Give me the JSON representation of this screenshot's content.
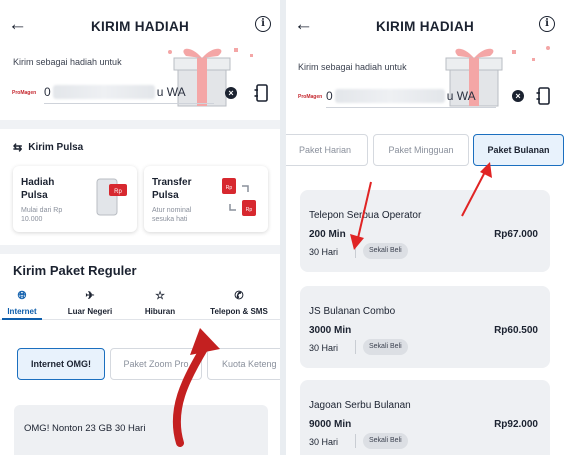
{
  "left": {
    "header": {
      "title": "KIRIM HADIAH",
      "back_icon": "arrow-left-icon",
      "info_icon": "info-icon"
    },
    "gift_label": "Kirim sebagai hadiah untuk",
    "provider_logo": "ProMagen",
    "phone": {
      "prefix": "0",
      "suffix": "u WA"
    },
    "pulsa": {
      "section_title": "Kirim Pulsa",
      "cards": [
        {
          "title": "Hadiah Pulsa",
          "subtitle": "Mulai dari Rp 10.000",
          "icon_text": "Rp"
        },
        {
          "title": "Transfer Pulsa",
          "subtitle": "Atur nominal sesuka hati",
          "icon_text": "Rp"
        }
      ]
    },
    "reguler": {
      "title": "Kirim Paket Reguler",
      "tabs": [
        {
          "label": "Internet",
          "icon": "globe-icon"
        },
        {
          "label": "Luar Negeri",
          "icon": "airplane-icon"
        },
        {
          "label": "Hiburan",
          "icon": "star-icon"
        },
        {
          "label": "Telepon & SMS",
          "icon": "phone-sms-icon"
        }
      ],
      "chips": [
        "Internet OMG!",
        "Paket Zoom Pro",
        "Kuota Keteng"
      ],
      "card_title": "OMG! Nonton 23 GB 30 Hari"
    }
  },
  "right": {
    "header": {
      "title": "KIRIM HADIAH",
      "back_icon": "arrow-left-icon",
      "info_icon": "info-icon"
    },
    "gift_label": "Kirim sebagai hadiah untuk",
    "provider_logo": "ProMagen",
    "phone": {
      "prefix": "0",
      "suffix": "u WA"
    },
    "period_tabs": [
      "Paket Harian",
      "Paket Mingguan",
      "Paket Bulanan"
    ],
    "packages": [
      {
        "name": "Telepon Serbua Operator",
        "quota": "200 Min",
        "price": "Rp67.000",
        "duration": "30 Hari",
        "badge": "Sekali Beli"
      },
      {
        "name": "JS Bulanan Combo",
        "quota": "3000 Min",
        "price": "Rp60.500",
        "duration": "30 Hari",
        "badge": "Sekali Beli"
      },
      {
        "name": "Jagoan Serbu Bulanan",
        "quota": "9000 Min",
        "price": "Rp92.000",
        "duration": "30 Hari",
        "badge": "Sekali Beli"
      }
    ]
  },
  "colors": {
    "accent": "#0e5eac",
    "annotation_red": "#e02424",
    "card_bg": "#eef0f3",
    "gift_pink": "#f4a6a6"
  }
}
